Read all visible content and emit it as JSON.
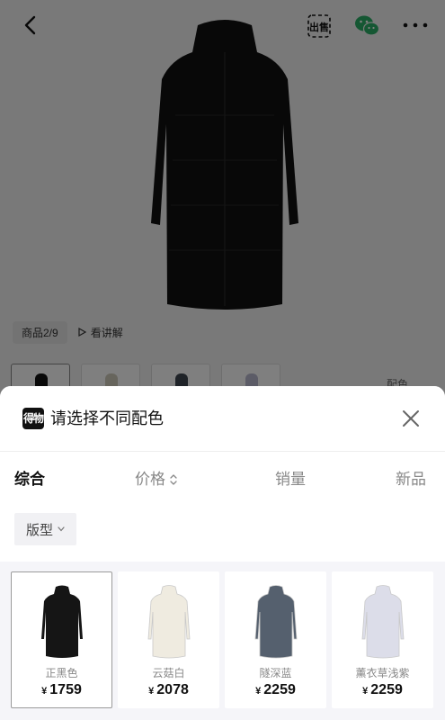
{
  "page": {
    "counter": "商品2/9",
    "lecture_label": "看讲解",
    "color_hint": "配色",
    "hero_color": "#111111",
    "thumb_colors": [
      "#111111",
      "#cfcabb",
      "#3f4650",
      "#b9b8cf"
    ]
  },
  "topbar": {
    "sell_label": "出售"
  },
  "sheet": {
    "logo_text": "得物",
    "title": "请选择不同配色",
    "sort": [
      {
        "label": "综合",
        "active": true
      },
      {
        "label": "价格",
        "active": false
      },
      {
        "label": "销量",
        "active": false
      },
      {
        "label": "新品",
        "active": false
      }
    ],
    "filter_label": "版型",
    "items": [
      {
        "name": "正黑色",
        "currency": "¥",
        "price": "1759",
        "color": "#151515",
        "selected": true
      },
      {
        "name": "云菇白",
        "currency": "¥",
        "price": "2078",
        "color": "#efebe0",
        "selected": false
      },
      {
        "name": "隧深蓝",
        "currency": "¥",
        "price": "2259",
        "color": "#55606e",
        "selected": false
      },
      {
        "name": "薰衣草浅紫",
        "currency": "¥",
        "price": "2259",
        "color": "#dcdde9",
        "selected": false
      }
    ]
  }
}
